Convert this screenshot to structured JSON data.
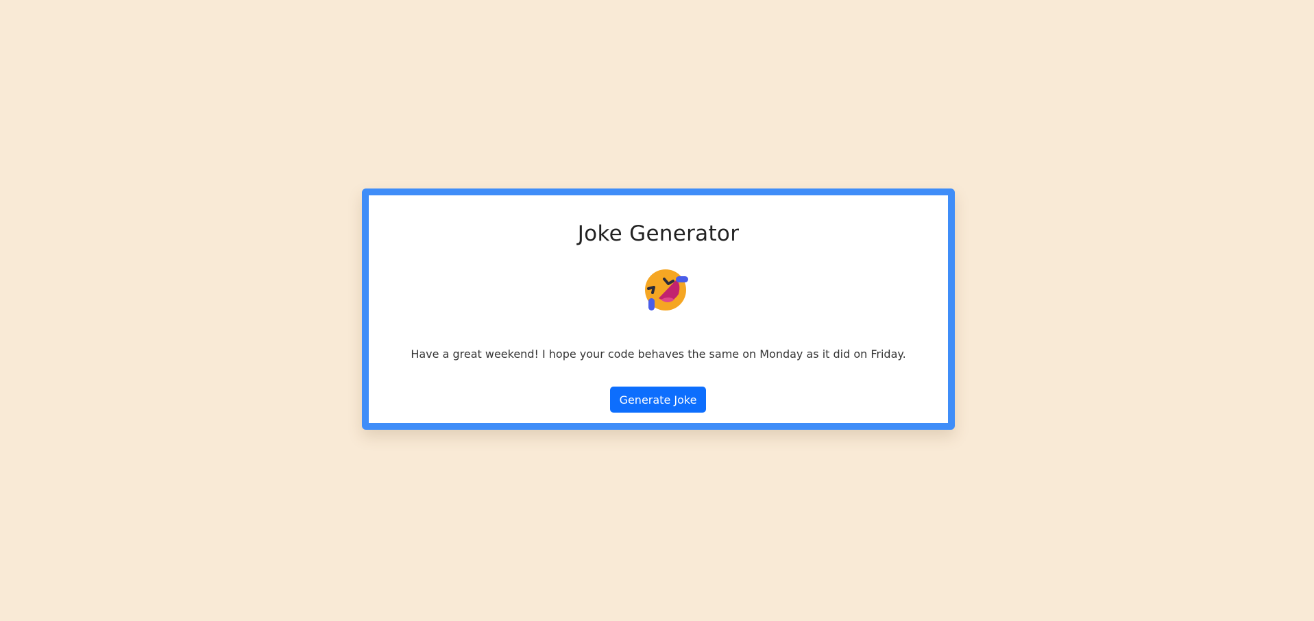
{
  "app": {
    "title": "Joke Generator"
  },
  "joke": {
    "icon": "rolling-on-the-floor-laughing-icon",
    "text": "Have a great weekend! I hope your code behaves the same on Monday as it did on Friday."
  },
  "actions": {
    "generate_label": "Generate Joke"
  },
  "colors": {
    "page_background": "#f9ead6",
    "card_border": "#3f8df8",
    "button": "#0d6efd"
  }
}
